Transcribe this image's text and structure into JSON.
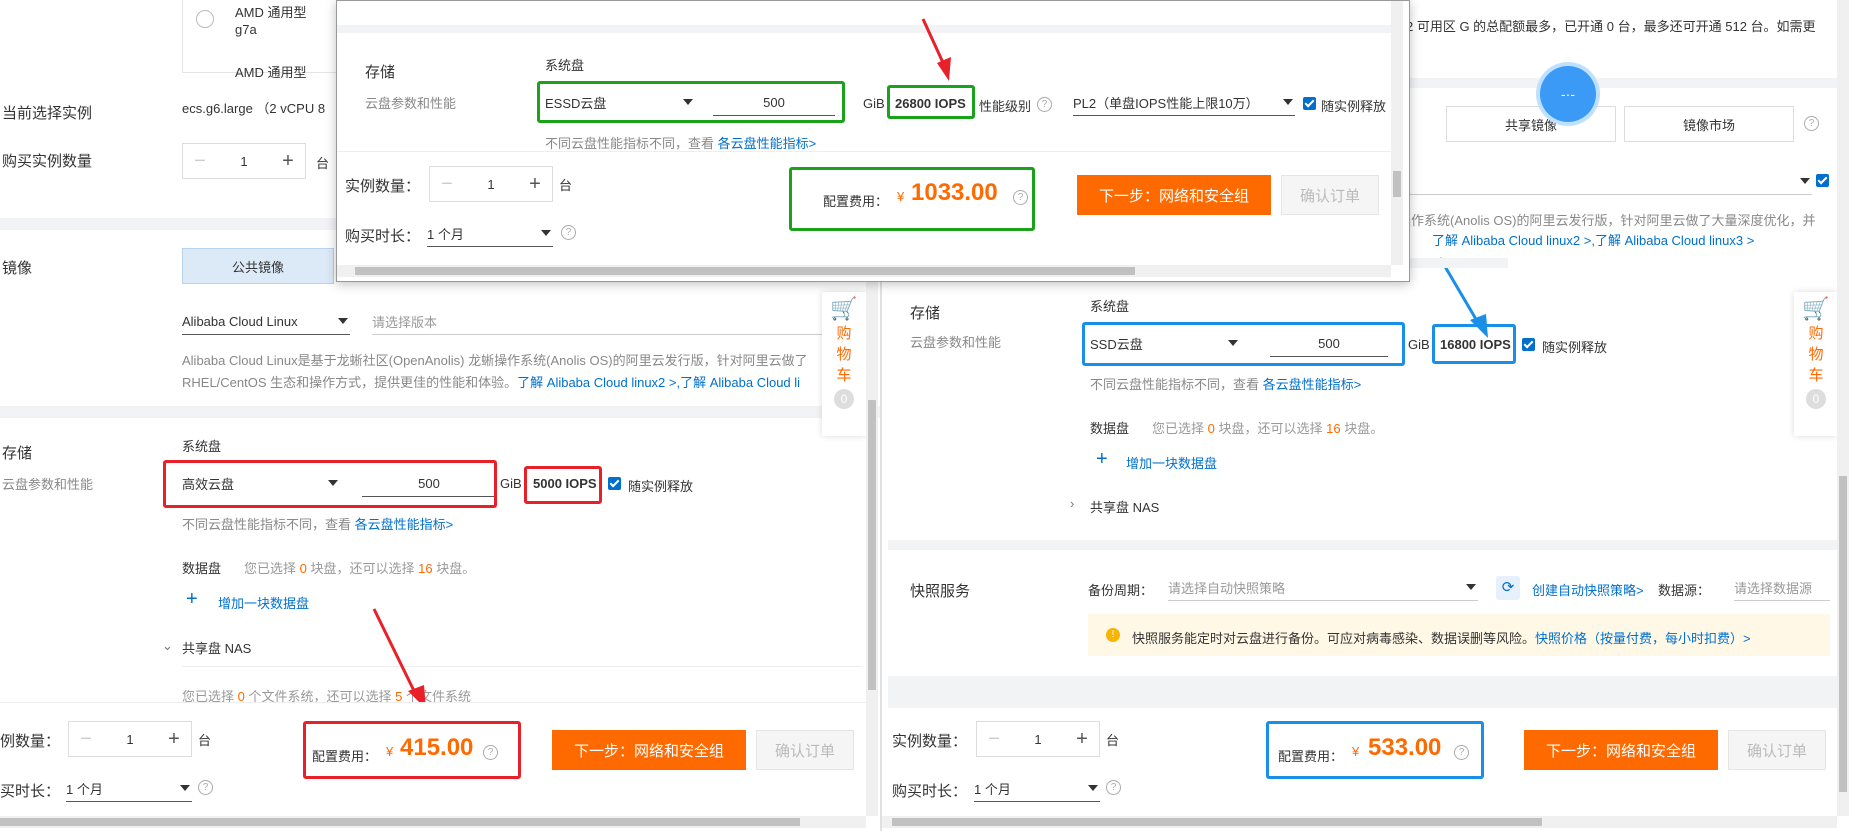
{
  "left": {
    "instance_option1": "AMD 通用型",
    "instance_option1_sub": "g7a",
    "instance_option2": "AMD 通用型",
    "current_instance_label": "当前选择实例",
    "current_instance_value": "ecs.g6.large （2 vCPU 8",
    "buy_count_label": "购买实例数量",
    "buy_count_value": "1",
    "buy_count_unit": "台",
    "image_label": "镜像",
    "image_tab_public": "公共镜像",
    "image_os": "Alibaba Cloud Linux",
    "image_version_placeholder": "请选择版本",
    "image_desc1": "Alibaba Cloud Linux是基于龙蜥社区(OpenAnolis) 龙蜥操作系统(Anolis OS)的阿里云发行版，针对阿里云做了",
    "image_desc2a": "RHEL/CentOS 生态和操作方式，提供更佳的性能和体验。",
    "image_desc2b": "了解 Alibaba Cloud linux2 >,",
    "image_desc2c": "了解 Alibaba Cloud li",
    "storage_label": "存储",
    "storage_sub": "云盘参数和性能",
    "system_disk": "系统盘",
    "disk_type": "高效云盘",
    "disk_size": "500",
    "gib": "GiB",
    "iops": "5000 IOPS",
    "release_with_instance": "随实例释放",
    "disk_note": "不同云盘性能指标不同，查看",
    "disk_note_link": "各云盘性能指标>",
    "data_disk": "数据盘",
    "data_disk_note_a": "您已选择",
    "data_disk_note_b": "0",
    "data_disk_note_c": "块盘，还可以选择",
    "data_disk_note_d": "16",
    "data_disk_note_e": "块盘。",
    "add_data_disk": "增加一块数据盘",
    "nas": "共享盘 NAS",
    "nas_note_a": "您已选择",
    "nas_note_b": "0",
    "nas_note_c": "个文件系统，还可以选择",
    "nas_note_d": "5",
    "nas_note_e": "个文件系统",
    "qty_label": "例数量：",
    "qty_value": "1",
    "qty_unit": "台",
    "duration_label": "买时长：",
    "duration_value": "1 个月",
    "fee_label": "配置费用：",
    "fee_currency": "¥",
    "fee_value": "415.00",
    "next_button": "下一步：网络和安全组",
    "confirm_button": "确认订单",
    "cart_line1": "购",
    "cart_line2": "物",
    "cart_line3": "车",
    "cart_count": "0"
  },
  "popup": {
    "storage_label": "存储",
    "storage_sub": "云盘参数和性能",
    "system_disk": "系统盘",
    "disk_type": "ESSD云盘",
    "disk_size": "500",
    "gib": "GiB",
    "iops": "26800 IOPS",
    "perf_level_label": "性能级别",
    "perf_level_value": "PL2（单盘IOPS性能上限10万）",
    "release_with_instance": "随实例释放",
    "disk_note": "不同云盘性能指标不同，查看",
    "disk_note_link": "各云盘性能指标>",
    "qty_label": "实例数量：",
    "qty_value": "1",
    "qty_unit": "台",
    "duration_label": "购买时长：",
    "duration_value": "1 个月",
    "fee_label": "配置费用：",
    "fee_currency": "¥",
    "fee_value": "1033.00",
    "next_button": "下一步：网络和安全组",
    "confirm_button": "确认订单"
  },
  "right": {
    "zone_text": "2 可用区 G 的总配额最多，已开通 0 台，最多还可开通 512 台。如需更",
    "tab_shared_image": "共享镜像",
    "tab_marketplace": "镜像市场",
    "image_desc1": "操作系统(Anolis OS)的阿里云发行版，针对阿里云做了大量深度优化，并",
    "image_desc2a": "了解 Alibaba Cloud linux2 >,",
    "image_desc2b": "了解 Alibaba Cloud linux3 >",
    "storage_label": "存储",
    "storage_sub": "云盘参数和性能",
    "system_disk": "系统盘",
    "disk_type": "SSD云盘",
    "disk_size": "500",
    "gib": "GiB",
    "iops": "16800 IOPS",
    "release_with_instance": "随实例释放",
    "disk_note": "不同云盘性能指标不同，查看",
    "disk_note_link": "各云盘性能指标>",
    "data_disk": "数据盘",
    "data_disk_note_a": "您已选择",
    "data_disk_note_b": "0",
    "data_disk_note_c": "块盘，还可以选择",
    "data_disk_note_d": "16",
    "data_disk_note_e": "块盘。",
    "add_data_disk": "增加一块数据盘",
    "nas": "共享盘 NAS",
    "snapshot_label": "快照服务",
    "backup_cycle_label": "备份周期：",
    "backup_cycle_placeholder": "请选择自动快照策略",
    "create_policy_link": "创建自动快照策略>",
    "data_source_label": "数据源：",
    "data_source_placeholder": "请选择数据源",
    "snapshot_notice": "快照服务能定时对云盘进行备份。可应对病毒感染、数据误删等风险。",
    "snapshot_price_link": "快照价格（按量付费，每小时扣费）>",
    "qty_label": "实例数量：",
    "qty_value": "1",
    "qty_unit": "台",
    "duration_label": "购买时长：",
    "duration_value": "1 个月",
    "fee_label": "配置费用：",
    "fee_currency": "¥",
    "fee_value": "533.00",
    "next_button": "下一步：网络和安全组",
    "confirm_button": "确认订单",
    "cart_line1": "购",
    "cart_line2": "物",
    "cart_line3": "车",
    "cart_count": "0",
    "float_button": "-·-"
  },
  "colors": {
    "orange": "#ff6a00",
    "link": "#0070cc",
    "red_highlight": "#e8202a",
    "green_highlight": "#1aa31a",
    "blue_highlight": "#1a8fe8"
  }
}
